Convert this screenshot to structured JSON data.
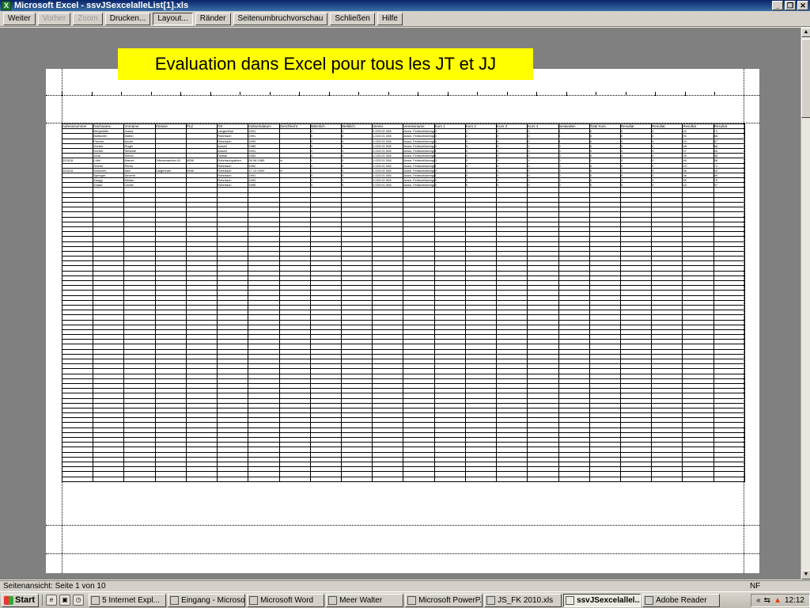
{
  "window": {
    "title": "Microsoft Excel - ssvJSexcelalleList[1].xls"
  },
  "toolbar": {
    "buttons": [
      {
        "label": "Weiter",
        "state": "normal"
      },
      {
        "label": "Vorher",
        "state": "disabled"
      },
      {
        "label": "Zoom",
        "state": "disabled"
      },
      {
        "label": "Drucken...",
        "state": "normal"
      },
      {
        "label": "Layout...",
        "state": "pressed"
      },
      {
        "label": "Ränder",
        "state": "normal"
      },
      {
        "label": "Seitenumbruchvorschau",
        "state": "normal"
      },
      {
        "label": "Schließen",
        "state": "normal"
      },
      {
        "label": "Hilfe",
        "state": "normal"
      }
    ]
  },
  "banner": {
    "text": "Evaluation dans Excel pour tous les JT et JJ",
    "color": "#ffff00"
  },
  "sheet": {
    "columns": [
      "Adressnummer",
      "Nachname",
      "Vorname",
      "Strasse",
      "PLZ",
      "Ort",
      "Geburtsdatum",
      "Geschlecht",
      "Männlich",
      "Weiblich",
      "Verein",
      "Vereinsname",
      "Kurs 1",
      "Kurs 2",
      "Kurs 3",
      "Kurs 4",
      "bestanden",
      "Total Kurs",
      "Resultat",
      "Resultat",
      "Resultat",
      "Resultat"
    ],
    "rows": [
      [
        "",
        "Bergmüller",
        "Joana",
        "",
        "",
        "Langenthal",
        "1991",
        "",
        "0",
        "0",
        "1.023.01.008",
        "Ausw. Feldschützengesellschaft",
        "0",
        "1",
        "0",
        "0",
        "1",
        "0",
        "0",
        "0",
        "42",
        "71"
      ],
      [
        "",
        "Buttikofer",
        "Martin",
        "",
        "",
        "Rohrbach",
        "1991",
        "",
        "0",
        "0",
        "1.023.01.008",
        "Ausw. Feldschützengesellschaft",
        "0",
        "1",
        "0",
        "0",
        "1",
        "0",
        "0",
        "0",
        "50",
        "68"
      ],
      [
        "",
        "Fischer",
        "André",
        "",
        "",
        "Rohrbach",
        "1992",
        "",
        "0",
        "0",
        "1.023.01.008",
        "Ausw. Feldschützengesellschaft",
        "0",
        "0",
        "0",
        "0",
        "1",
        "0",
        "0",
        "0",
        "53",
        "57"
      ],
      [
        "",
        "Gerber",
        "Roger",
        "",
        "",
        "Auswil",
        "1989",
        "",
        "0",
        "0",
        "1.023.01.008",
        "Ausw. Feldschützengesellschaft",
        "0",
        "0",
        "0",
        "1",
        "0",
        "0",
        "0",
        "0",
        "48",
        "68"
      ],
      [
        "",
        "Gerber",
        "Stefanie",
        "",
        "",
        "Auswil",
        "1991",
        "",
        "0",
        "0",
        "1.023.01.008",
        "Ausw. Feldschützengesellschaft",
        "1",
        "0",
        "0",
        "0",
        "0",
        "0",
        "0",
        "0",
        "37",
        "55"
      ],
      [
        "",
        "Jordi",
        "Simon",
        "",
        "",
        "Huttwil",
        "1992",
        "",
        "0",
        "0",
        "1.023.01.008",
        "Ausw. Feldschützengesellschaft",
        "1",
        "0",
        "0",
        "0",
        "0",
        "0",
        "0",
        "0",
        "39",
        "38"
      ],
      [
        "320118",
        "Lüthi",
        "Marcel",
        "Othmarsachen 61",
        "4938",
        "Rohrbachgraben",
        "05.06.1989",
        "m",
        "1",
        "0",
        "1.023.01.008",
        "Ausw. Feldschützengesellschaft",
        "0",
        "0",
        "0",
        "1",
        "0",
        "1",
        "0",
        "0",
        "46",
        "58"
      ],
      [
        "",
        "Oberer",
        "Remo",
        "",
        "",
        "Rohrbach",
        "1992",
        "",
        "0",
        "0",
        "1.023.01.008",
        "Ausw. Feldschützengesellschaft",
        "1",
        "0",
        "0",
        "0",
        "0",
        "0",
        "0",
        "0",
        "43",
        "71"
      ],
      [
        "320118",
        "Schuberl",
        "Alex",
        "Galgenrain",
        "4938",
        "Rohrbach",
        "17.10.1990",
        "m",
        "1",
        "0",
        "1.023.01.008",
        "Ausw. Feldschützengesellschaft",
        "0",
        "1",
        "0",
        "0",
        "0",
        "0",
        "0",
        "0",
        "36",
        "53"
      ],
      [
        "",
        "Springer",
        "Severin",
        "",
        "",
        "Rohrbach",
        "1991",
        "",
        "0",
        "0",
        "1.023.01.008",
        "Ausw. Feldschützengesellschaft",
        "1",
        "0",
        "0",
        "0",
        "0",
        "0",
        "0",
        "0",
        "48",
        "69"
      ],
      [
        "",
        "Zaugg",
        "Miriam",
        "",
        "",
        "Rohrbach",
        "1992",
        "",
        "0",
        "0",
        "1.023.01.008",
        "Ausw. Feldschützengesellschaft",
        "0",
        "0",
        "0",
        "0",
        "0",
        "0",
        "0",
        "0",
        "39",
        "70"
      ],
      [
        "",
        "Zulauf",
        "Cédric",
        "",
        "",
        "Rohrbach",
        "1990",
        "",
        "0",
        "0",
        "1.023.01.008",
        "Ausw. Feldschützengesellschaft",
        "0",
        "0",
        "0",
        "0",
        "0",
        "0",
        "0",
        "0",
        "43",
        "57"
      ]
    ],
    "filler_rows": 60
  },
  "statusbar": {
    "left": "Seitenansicht: Seite 1 von 10",
    "right": "NF"
  },
  "taskbar": {
    "start": "Start",
    "quicklaunch": [
      "",
      "",
      ""
    ],
    "tasks": [
      {
        "label": "5 Internet Expl...",
        "active": false
      },
      {
        "label": "Eingang - Microso...",
        "active": false
      },
      {
        "label": "Microsoft Word",
        "active": false
      },
      {
        "label": "Meer Walter",
        "active": false
      },
      {
        "label": "Microsoft PowerP...",
        "active": false
      },
      {
        "label": "JS_FK 2010.xls",
        "active": false
      },
      {
        "label": "ssvJSexcelallel...",
        "active": true
      },
      {
        "label": "Adobe Reader",
        "active": false
      }
    ],
    "clock": "12:12"
  }
}
